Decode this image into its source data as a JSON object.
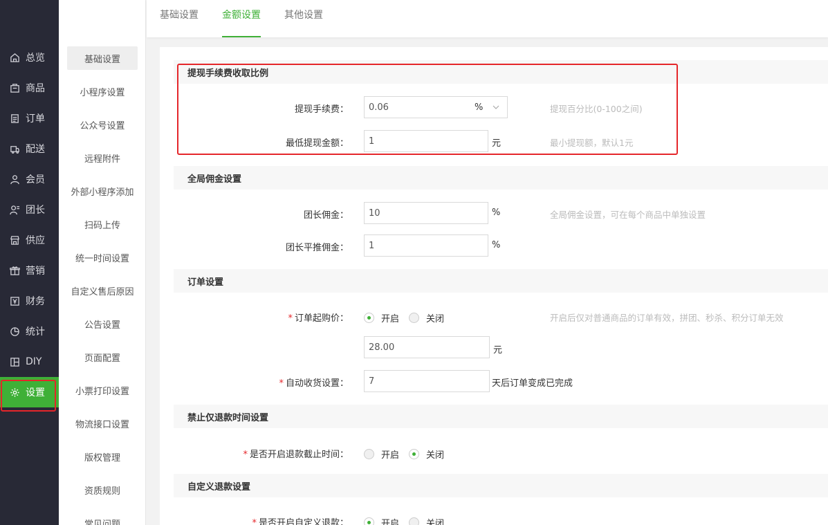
{
  "nav": {
    "items": [
      {
        "label": "总览",
        "icon": "home-icon"
      },
      {
        "label": "商品",
        "icon": "box-icon"
      },
      {
        "label": "订单",
        "icon": "order-icon"
      },
      {
        "label": "配送",
        "icon": "delivery-icon"
      },
      {
        "label": "会员",
        "icon": "user-icon"
      },
      {
        "label": "团长",
        "icon": "leader-icon"
      },
      {
        "label": "供应",
        "icon": "store-icon"
      },
      {
        "label": "营销",
        "icon": "gift-icon"
      },
      {
        "label": "财务",
        "icon": "wallet-icon"
      },
      {
        "label": "统计",
        "icon": "pie-icon"
      },
      {
        "label": "DIY",
        "icon": "layout-icon"
      },
      {
        "label": "设置",
        "icon": "gear-icon",
        "active": true
      }
    ]
  },
  "subnav": {
    "items": [
      "基础设置",
      "小程序设置",
      "公众号设置",
      "远程附件",
      "外部小程序添加",
      "扫码上传",
      "统一时间设置",
      "自定义售后原因",
      "公告设置",
      "页面配置",
      "小票打印设置",
      "物流接口设置",
      "版权管理",
      "资质规则",
      "常见问题"
    ]
  },
  "tabs": {
    "basic": "基础设置",
    "amount": "金额设置",
    "other": "其他设置"
  },
  "withdraw": {
    "title": "提现手续费收取比例",
    "fee_label": "提现手续费：",
    "fee_value": "0.06",
    "fee_unit": "%",
    "fee_hint": "提现百分比(0-100之间)",
    "min_label": "最低提现金额：",
    "min_value": "1",
    "min_unit": "元",
    "min_hint": "最小提现额，默认1元"
  },
  "commission": {
    "title": "全局佣金设置",
    "leader_label": "团长佣金：",
    "leader_value": "10",
    "leader_unit": "%",
    "leader_hint": "全局佣金设置，可在每个商品中单独设置",
    "flat_label": "团长平推佣金：",
    "flat_value": "1",
    "flat_unit": "%"
  },
  "order": {
    "title": "订单设置",
    "min_price_label": "订单起购价：",
    "open": "开启",
    "close": "关闭",
    "min_price_state": "open",
    "min_price_hint": "开启后仅对普通商品的订单有效，拼团、秒杀、积分订单无效",
    "min_price_value": "28.00",
    "min_price_unit": "元",
    "auto_receive_label": "自动收货设置：",
    "auto_receive_value": "7",
    "auto_receive_unit": "天后订单变成已完成"
  },
  "refund_time": {
    "title": "禁止仅退款时间设置",
    "label": "是否开启退款截止时间：",
    "open": "开启",
    "close": "关闭",
    "state": "close"
  },
  "custom_refund": {
    "title": "自定义退款设置",
    "label": "是否开启自定义退款：",
    "open": "开启",
    "close": "关闭",
    "state": "open"
  },
  "colors": {
    "accent": "#3fb037",
    "nav_bg": "#282936",
    "highlight": "#e5262a"
  }
}
